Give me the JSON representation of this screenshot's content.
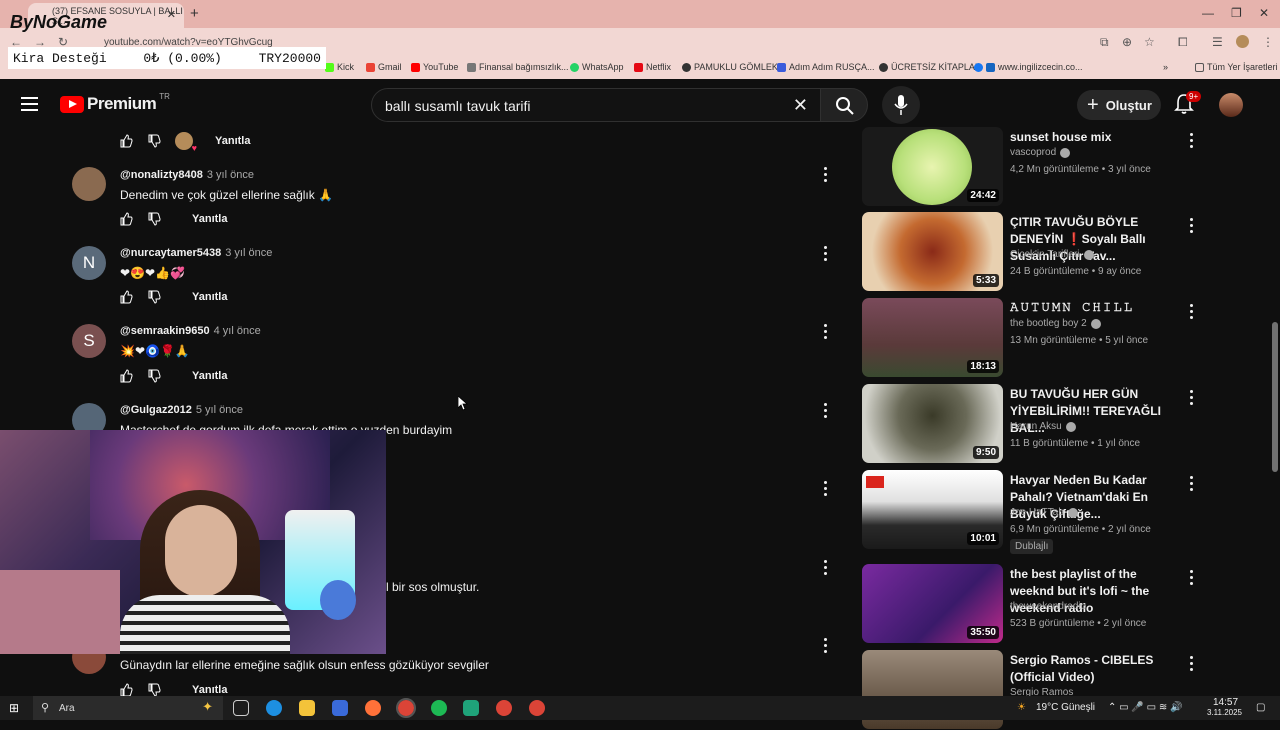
{
  "browser": {
    "tab_title": "(37) EFSANE SOSUYLA | BALLI S...",
    "url": "youtube.com/watch?v=eoYTGhvGcug",
    "bookmarks": [
      "Kick",
      "Gmail",
      "YouTube",
      "Finansal bağımsızlık...",
      "WhatsApp",
      "Netflix",
      "PAMUKLU GÖMLEK",
      "Adım Adım RUSÇA...",
      "ÜCRETSİZ KİTAPLAR",
      "www.ingilizcecin.co...",
      "Tüm Yer İşaretleri"
    ]
  },
  "overlay": {
    "logo": "ByNoGame",
    "kira_label": "Kira Desteği",
    "kira_value": "0₺ (0.00%)",
    "kira_goal": "TRY20000"
  },
  "header": {
    "brand": "Premium",
    "region": "TR",
    "search_query": "ballı susamlı tavuk tarifi",
    "create_label": "Oluştur",
    "notif_badge": "9+"
  },
  "comments": {
    "reply_label": "Yanıtla",
    "items": [
      {
        "author": "@nonalizty8408",
        "time": "3 yıl önce",
        "text": "Denedim ve çok güzel ellerine sağlık 🙏",
        "initial": "",
        "color": "#8a6a50"
      },
      {
        "author": "@nurcaytamer5438",
        "time": "3 yıl önce",
        "text": "❤😍❤👍💞",
        "initial": "N",
        "color": "#5a6a7a"
      },
      {
        "author": "@semraakin9650",
        "time": "4 yıl önce",
        "text": "💥❤🧿🌹🙏",
        "initial": "S",
        "color": "#7a5050"
      },
      {
        "author": "@Gulgaz2012",
        "time": "5 yıl önce",
        "text": "Masterchef de gordum ilk defa merak ettim o yuzden burdayim",
        "initial": "",
        "color": "#556677"
      }
    ],
    "partial_text_1": "l bir sos olmuştur.",
    "partial_text_2": "Günaydın lar ellerine emeğine sağlık olsun enfess gözüküyor sevgiler"
  },
  "sidebar": {
    "videos": [
      {
        "title": "sunset house mix",
        "channel": "vascoprod",
        "meta": "4,2 Mn görüntüleme • 3 yıl önce",
        "duration": "24:42",
        "thumb": "#1a1a1a"
      },
      {
        "title": "ÇITIR TAVUĞU BÖYLE DENEYİN ❗Soyalı Ballı Susamlı Çıtır Tav...",
        "channel": "Çiçek'in Tarifleri",
        "meta": "24 B görüntüleme • 9 ay önce",
        "duration": "5:33",
        "thumb": "#7a4a28"
      },
      {
        "title": "𝙰𝚄𝚃𝚄𝙼𝙽 𝙲𝙷𝙸𝙻𝙻",
        "channel": "the bootleg boy 2",
        "meta": "13 Mn görüntüleme • 5 yıl önce",
        "duration": "18:13",
        "thumb": "#6e4a52"
      },
      {
        "title": "BU TAVUĞU HER GÜN YİYEBİLİRİM!! TEREYAĞLI BAL...",
        "channel": "Harun Aksu",
        "meta": "11 B görüntüleme • 1 yıl önce",
        "duration": "9:50",
        "thumb": "#3a3a30"
      },
      {
        "title": "Havyar Neden Bu Kadar Pahalı? Vietnam'daki En Büyük Çiftliğe...",
        "channel": "Joe HaTTab",
        "meta": "6,9 Mn görüntüleme • 2 yıl önce",
        "duration": "10:01",
        "thumb": "#9a8a7a",
        "badge": "Dublajlı"
      },
      {
        "title": "the best playlist of the weeknd but it's lofi ~ the weekend radio",
        "channel": "theweekendradio",
        "meta": "523 B görüntüleme • 2 yıl önce",
        "duration": "35:50",
        "thumb": "#5a2a7a"
      },
      {
        "title": "Sergio Ramos - CIBELES (Official Video)",
        "channel": "Sergio Ramos",
        "meta": "",
        "duration": "",
        "thumb": "#7a6a5a"
      }
    ]
  },
  "taskbar": {
    "search_placeholder": "Ara",
    "weather": "19°C  Güneşli",
    "time": "14:57",
    "date": "3.11.2025"
  }
}
